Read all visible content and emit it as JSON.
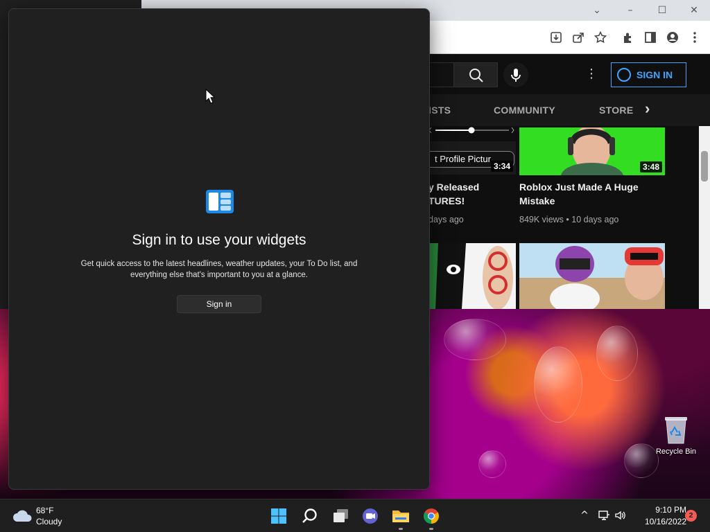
{
  "browser": {
    "window_controls": {
      "chevron": "⌄",
      "minimize": "–",
      "maximize": "☐",
      "close": "✕"
    },
    "youtube": {
      "header": {
        "signin_label": "SIGN IN",
        "more_glyph": "⋮"
      },
      "tabs": [
        {
          "label": "ISTS"
        },
        {
          "label": "COMMUNITY"
        },
        {
          "label": "STORE"
        }
      ],
      "tabs_next_glyph": "›",
      "videos": [
        {
          "title_line1": "y Released",
          "title_line2": "TURES!",
          "meta": "days ago",
          "duration": "3:34",
          "thumb_caption": "t Profile Pictur"
        },
        {
          "title_line1": "Roblox Just Made A Huge",
          "title_line2": "Mistake",
          "meta": "849K views • 10 days ago",
          "duration": "3:48"
        }
      ]
    }
  },
  "widgets": {
    "title": "Sign in to use your widgets",
    "description": "Get quick access to the latest headlines, weather updates, your To Do list, and everything else that's important to you at a glance.",
    "signin_button": "Sign in"
  },
  "desktop": {
    "recycle_bin_label": "Recycle Bin"
  },
  "taskbar": {
    "weather": {
      "temp": "68°F",
      "condition": "Cloudy"
    },
    "apps": [
      "windows-start-icon",
      "search-icon",
      "task-view-icon",
      "teams-chat-icon",
      "file-explorer-icon",
      "chrome-icon"
    ],
    "tray": {
      "chevron": "^",
      "time": "9:10 PM",
      "date": "10/16/2022",
      "notifications": "2"
    }
  },
  "colors": {
    "youtube_blue": "#3ea6ff",
    "widgets_bg": "#202020",
    "taskbar_bg": "#1f1f1f",
    "notification_badge": "#f25c54"
  }
}
